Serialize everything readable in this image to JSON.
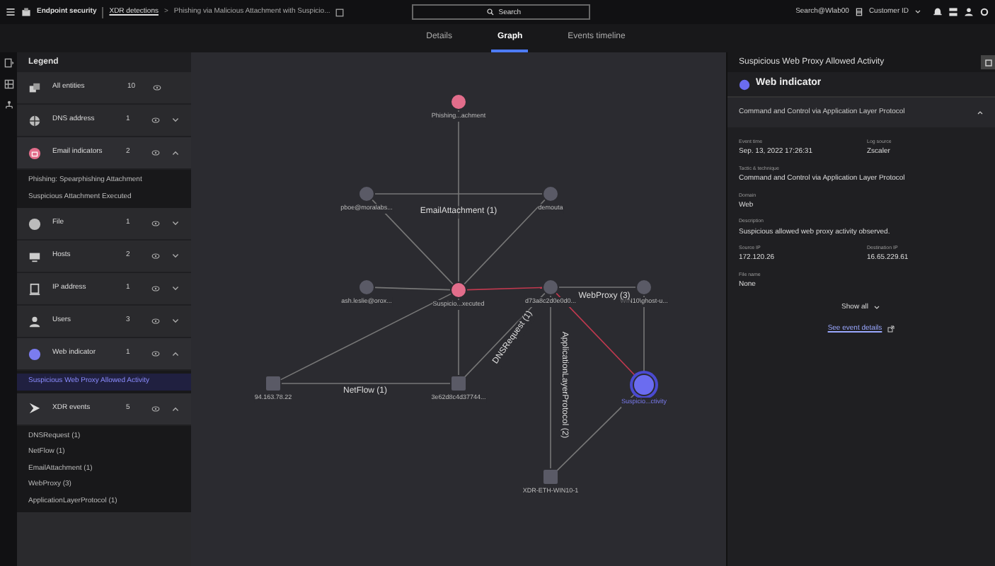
{
  "top_bar": {
    "product": "Endpoint security",
    "breadcrumb_link": "XDR detections",
    "separator": ">",
    "page_title": "Phishing via Malicious Attachment with Suspicio...",
    "search": {
      "placeholder": "Search"
    },
    "user": "Search@Wlab00",
    "customer": "Customer ID"
  },
  "tabs": [
    {
      "label": "Details",
      "selected": false
    },
    {
      "label": "Graph",
      "selected": true
    },
    {
      "label": "Events timeline",
      "selected": false
    }
  ],
  "legend": {
    "title": "Legend",
    "items": [
      {
        "kind": "all",
        "label": "All entities",
        "count": "10"
      },
      {
        "kind": "dns",
        "label": "DNS address",
        "count": "1",
        "expanded": false
      },
      {
        "kind": "email",
        "label": "Email indicators",
        "count": "2",
        "expanded": true,
        "children": [
          {
            "label": "Phishing: Spearphishing Attachment",
            "selected": false
          },
          {
            "label": "Suspicious Attachment Executed",
            "selected": false
          }
        ]
      },
      {
        "kind": "file",
        "label": "File",
        "count": "1",
        "expanded": false
      },
      {
        "kind": "host",
        "label": "Hosts",
        "count": "2",
        "expanded": false
      },
      {
        "kind": "ip",
        "label": "IP address",
        "count": "1",
        "expanded": false
      },
      {
        "kind": "user",
        "label": "Users",
        "count": "3",
        "expanded": false
      },
      {
        "kind": "web",
        "label": "Web indicator",
        "count": "1",
        "expanded": true,
        "children": [
          {
            "label": "Suspicious Web Proxy Allowed Activity",
            "selected": true
          }
        ]
      },
      {
        "kind": "events",
        "label": "XDR events",
        "count": "5",
        "expanded": true,
        "children": [
          {
            "label": "DNSRequest (1)",
            "selected": false
          },
          {
            "label": "NetFlow (1)",
            "selected": false
          },
          {
            "label": "EmailAttachment (1)",
            "selected": false
          },
          {
            "label": "WebProxy (3)",
            "selected": false
          },
          {
            "label": "ApplicationLayerProtocol (1)",
            "selected": false
          }
        ]
      }
    ]
  },
  "graph": {
    "nodes": [
      {
        "kind": "email",
        "label": "Phishing...achment",
        "selected": false
      },
      {
        "kind": "user",
        "label": "pboe@moralabs...",
        "selected": false
      },
      {
        "kind": "file",
        "label": "demouta",
        "selected": false
      },
      {
        "kind": "user",
        "label": "ash.leslie@orox...",
        "selected": false
      },
      {
        "kind": "email",
        "label": "Suspicio...xecuted",
        "selected": false
      },
      {
        "kind": "file",
        "label": "d73a8c2d0e0d0...",
        "selected": false
      },
      {
        "kind": "user",
        "label": "WIN10\\ghost-u...",
        "selected": false
      },
      {
        "kind": "host",
        "label": "94.163.78.22",
        "selected": false
      },
      {
        "kind": "host",
        "label": "3e62d8c4d37744...",
        "selected": false
      },
      {
        "kind": "web",
        "label": "Suspicio...ctivity",
        "selected": true
      },
      {
        "kind": "host",
        "label": "XDR-ETH-WIN10-1",
        "selected": false
      }
    ],
    "edge_labels": [
      "EmailAttachment (1)",
      "WebProxy (3)",
      "DNSRequest (1)",
      "NetFlow (1)",
      "ApplicationLayerProtocol (2)"
    ]
  },
  "details": {
    "title": "Suspicious Web Proxy Allowed Activity",
    "section": "Web indicator",
    "accordion": {
      "label": "Command and Control via Application Layer Protocol",
      "expanded": true
    },
    "fields": [
      {
        "label": "Event time",
        "value": "Sep. 13, 2022 17:26:31"
      },
      {
        "label": "Log source",
        "value": "Zscaler"
      },
      {
        "label": "Tactic & technique",
        "value": "Command and Control via Application Layer Protocol",
        "kind": "wide"
      },
      {
        "label": "Domain",
        "value": "Web",
        "kind": "wide"
      },
      {
        "label": "Description",
        "value": "Suspicious allowed web proxy activity observed.",
        "kind": "wide"
      },
      {
        "label": "Source IP",
        "value": "172.120.26"
      },
      {
        "label": "Destination IP",
        "value": "16.65.229.61"
      },
      {
        "label": "File name",
        "value": "None",
        "kind": "wide"
      }
    ],
    "show_all": "Show all",
    "event_link": "See event details"
  }
}
